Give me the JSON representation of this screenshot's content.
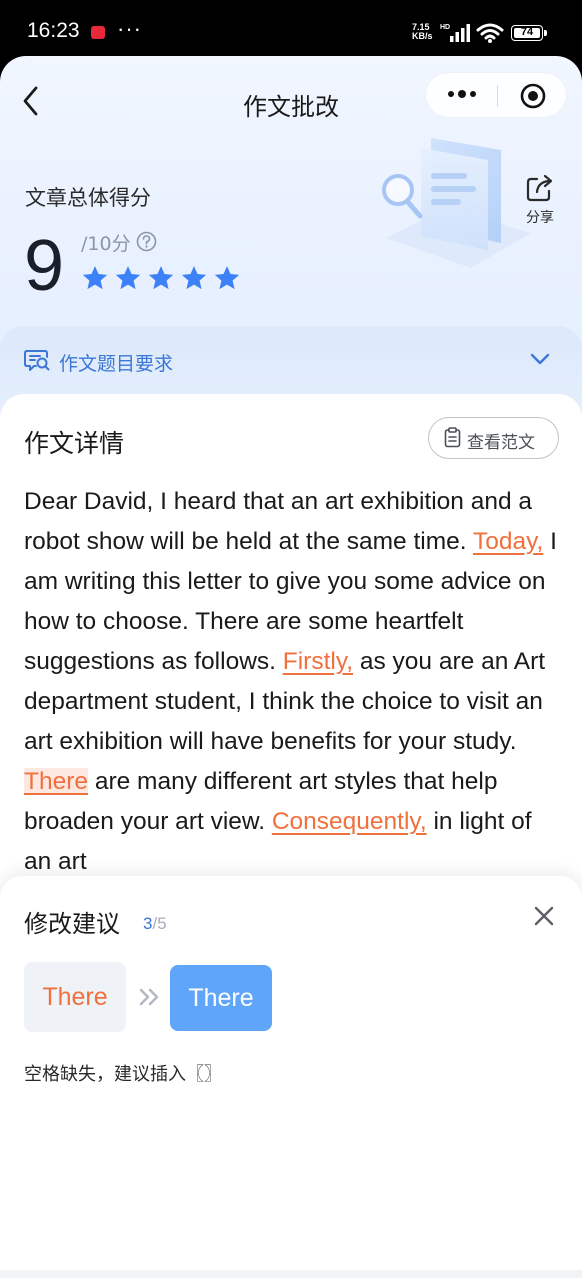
{
  "status_bar": {
    "time": "16:23",
    "menu_dots": "···",
    "net_speed_value": "7.15",
    "net_speed_unit": "KB/s",
    "hd_label": "HD",
    "battery_level": "74"
  },
  "header": {
    "title": "作文批改"
  },
  "score": {
    "label": "文章总体得分",
    "value": "9",
    "max": "/10分",
    "stars_filled": 5,
    "stars_total": 5,
    "star_color": "#3c82f6"
  },
  "share": {
    "label": "分享"
  },
  "requirements": {
    "label": "作文题目要求"
  },
  "essay": {
    "title": "作文详情",
    "view_sample_label": "查看范文",
    "segments": [
      {
        "text": "Dear David, I heard that an art exhibition and a robot show will be held at the same time. ",
        "type": "normal"
      },
      {
        "text": "Today,",
        "type": "error"
      },
      {
        "text": " I am writing this letter to give you some advice on how to choose. There are some heartfelt suggestions as follows. ",
        "type": "normal"
      },
      {
        "text": "Firstly,",
        "type": "error"
      },
      {
        "text": " as you are an Art department student, I think the choice to visit an art exhibition will have benefits for your study. ",
        "type": "normal"
      },
      {
        "text": "There",
        "type": "error-active"
      },
      {
        "text": " are many different art styles that help broaden your art view. ",
        "type": "normal"
      },
      {
        "text": "Consequently,",
        "type": "error"
      },
      {
        "text": " in light of an art",
        "type": "normal"
      }
    ]
  },
  "suggestion": {
    "title": "修改建议",
    "current": "3",
    "total": "/5",
    "original": "There",
    "corrected": "There",
    "note": "空格缺失，建议插入〖〗"
  },
  "colors": {
    "accent_blue": "#3c77d8",
    "error_orange": "#f0703e",
    "chip_blue": "#5fa6fb"
  }
}
